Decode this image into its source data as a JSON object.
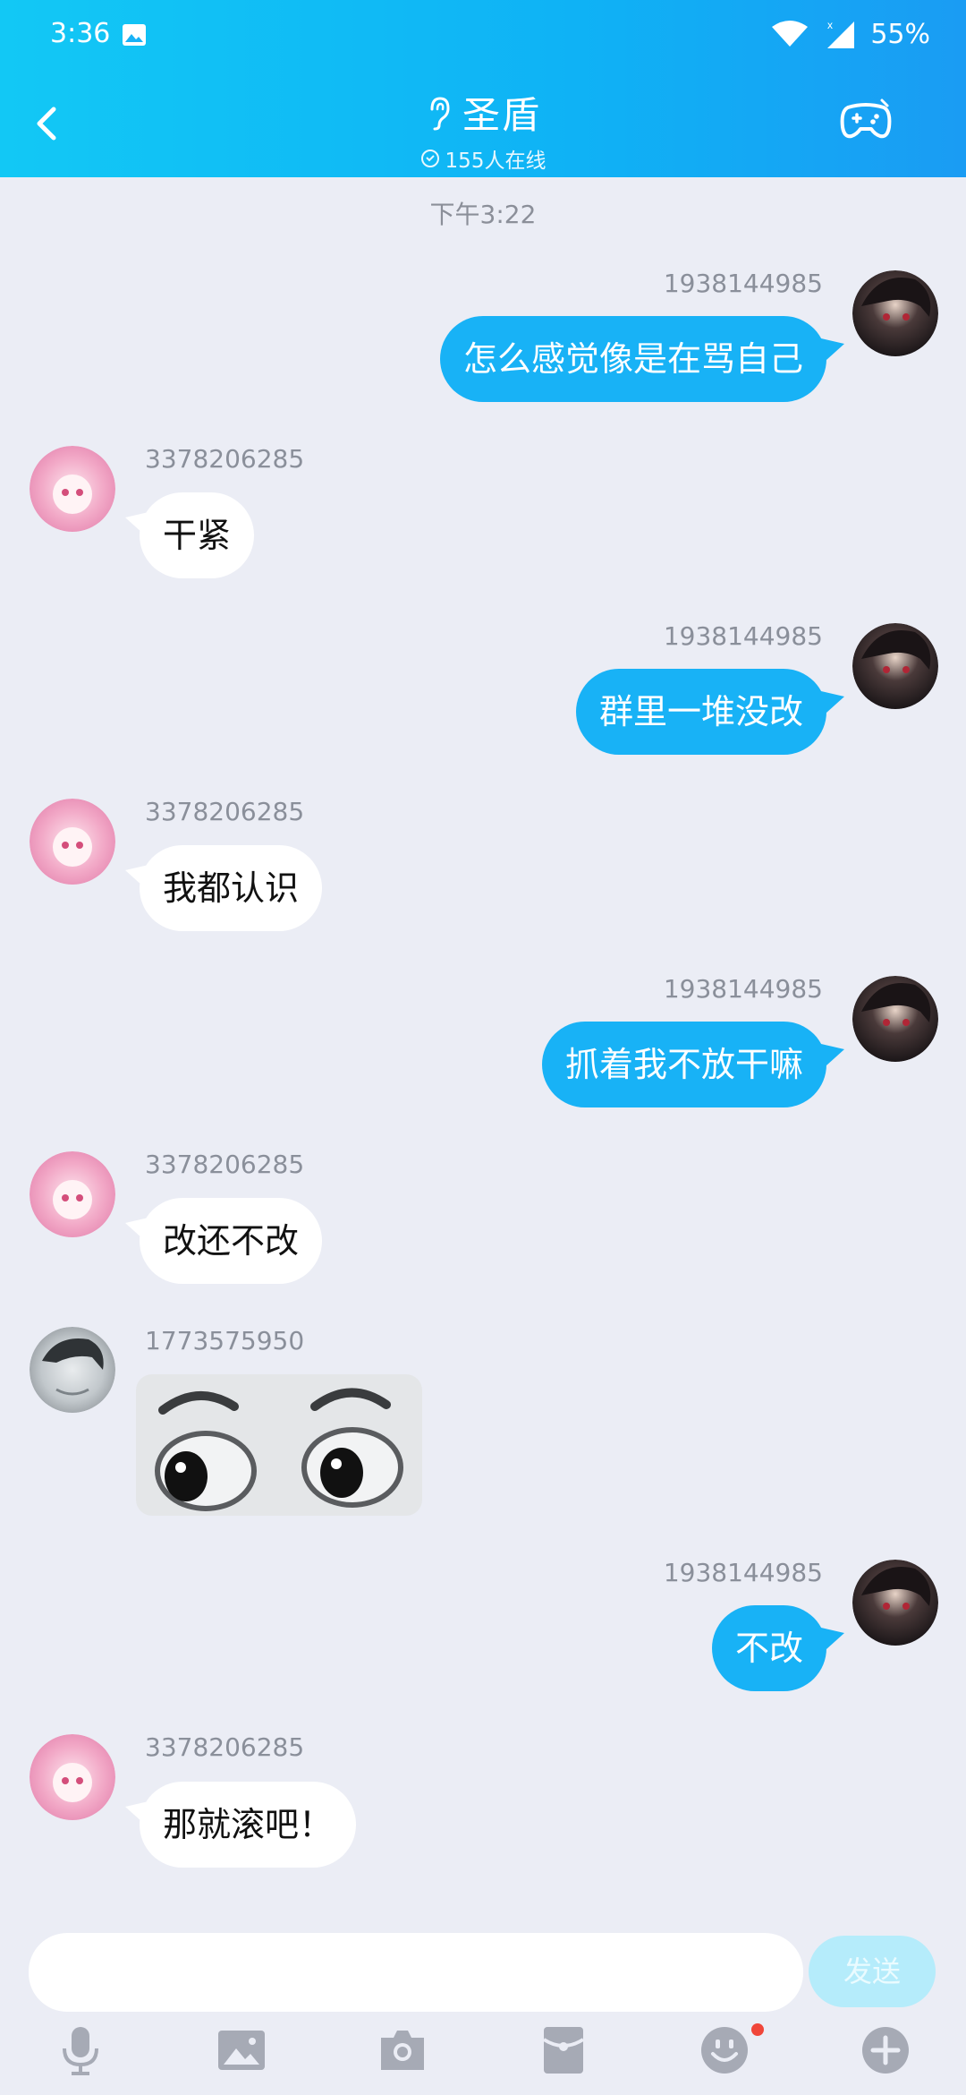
{
  "status": {
    "time": "3:36",
    "battery": "55%"
  },
  "header": {
    "title": "圣盾",
    "online": "155人在线"
  },
  "timestamp": "下午3:22",
  "messages": [
    {
      "sender": "1938144985",
      "text": "怎么感觉像是在骂自己"
    },
    {
      "sender": "3378206285",
      "text": "干紧"
    },
    {
      "sender": "1938144985",
      "text": "群里一堆没改"
    },
    {
      "sender": "3378206285",
      "text": "我都认识"
    },
    {
      "sender": "1938144985",
      "text": "抓着我不放干嘛"
    },
    {
      "sender": "3378206285",
      "text": "改还不改"
    },
    {
      "sender": "1773575950",
      "text": ""
    },
    {
      "sender": "1938144985",
      "text": "不改"
    },
    {
      "sender": "3378206285",
      "text": "那就滚吧！"
    }
  ],
  "input": {
    "send_label": "发送"
  },
  "toolbar": [
    "microphone-icon",
    "image-icon",
    "camera-icon",
    "red-packet-icon",
    "emoji-icon",
    "plus-icon"
  ],
  "colors": {
    "accent": "#18b2f6",
    "background": "#ebedf5"
  }
}
